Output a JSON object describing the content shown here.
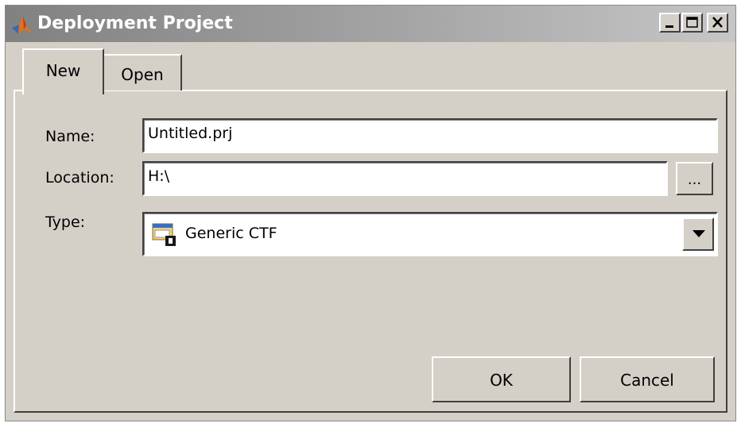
{
  "window": {
    "title": "Deployment Project",
    "controls": {
      "minimize": "minimize-icon",
      "maximize": "maximize-icon",
      "close": "close-icon"
    }
  },
  "tabs": [
    {
      "label": "New",
      "selected": true
    },
    {
      "label": "Open",
      "selected": false
    }
  ],
  "form": {
    "name_label": "Name:",
    "name_value": "Untitled.prj",
    "location_label": "Location:",
    "location_value": "H:\\",
    "browse_label": "...",
    "type_label": "Type:",
    "type_value": "Generic CTF",
    "type_icon": "generic-ctf-icon"
  },
  "buttons": {
    "ok": "OK",
    "cancel": "Cancel"
  },
  "colors": {
    "title_bar": "#a0a0a0",
    "dialog_face": "#d4d0c8",
    "field_bg": "#ffffff"
  }
}
